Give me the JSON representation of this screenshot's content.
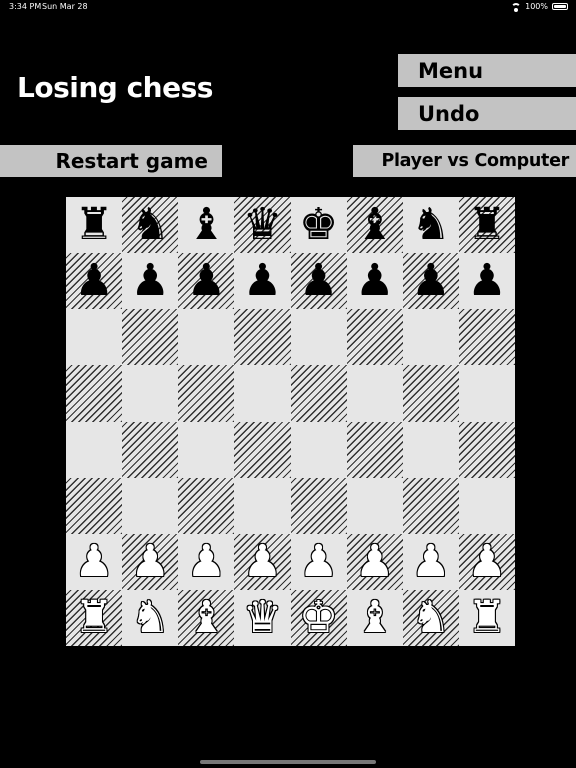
{
  "status_bar": {
    "time": "3:34 PM",
    "date": "Sun Mar 28",
    "battery": "100%"
  },
  "title": "Losing chess",
  "buttons": {
    "menu": "Menu",
    "undo": "Undo",
    "restart": "Restart game",
    "mode": "Player vs Computer"
  },
  "board": {
    "rows": [
      [
        "r",
        "n",
        "b",
        "q",
        "k",
        "b",
        "n",
        "r"
      ],
      [
        "p",
        "p",
        "p",
        "p",
        "p",
        "p",
        "p",
        "p"
      ],
      [
        "",
        "",
        "",
        "",
        "",
        "",
        "",
        ""
      ],
      [
        "",
        "",
        "",
        "",
        "",
        "",
        "",
        ""
      ],
      [
        "",
        "",
        "",
        "",
        "",
        "",
        "",
        ""
      ],
      [
        "",
        "",
        "",
        "",
        "",
        "",
        "",
        ""
      ],
      [
        "P",
        "P",
        "P",
        "P",
        "P",
        "P",
        "P",
        "P"
      ],
      [
        "R",
        "N",
        "B",
        "Q",
        "K",
        "B",
        "N",
        "R"
      ]
    ],
    "piece_names": {
      "r": "black-rook",
      "n": "black-knight",
      "b": "black-bishop",
      "q": "black-queen",
      "k": "black-king",
      "p": "black-pawn",
      "R": "white-rook",
      "N": "white-knight",
      "B": "white-bishop",
      "Q": "white-queen",
      "K": "white-king",
      "P": "white-pawn"
    },
    "light_color": "#e6e6e6",
    "dark_hatch_color": "#303030"
  }
}
